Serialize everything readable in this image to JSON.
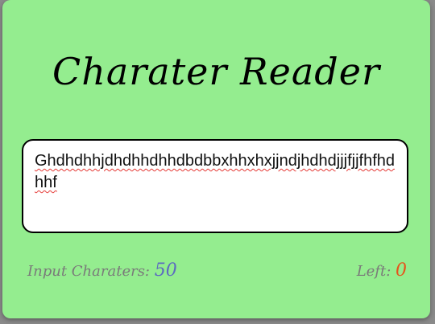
{
  "app": {
    "title": "Charater Reader"
  },
  "input": {
    "value": "Ghdhdhhjdhdhhdhhdbdbbxhhxhxjjndjhdhdjjjfjjfhfhdhhf"
  },
  "stats": {
    "input_label": "Input Charaters:",
    "input_count": "50",
    "left_label": "Left:",
    "left_count": "0"
  },
  "colors": {
    "background": "#94ed8f",
    "input_count": "#5c6bc0",
    "left_count": "#e6531b",
    "label": "#7a7a7a"
  }
}
